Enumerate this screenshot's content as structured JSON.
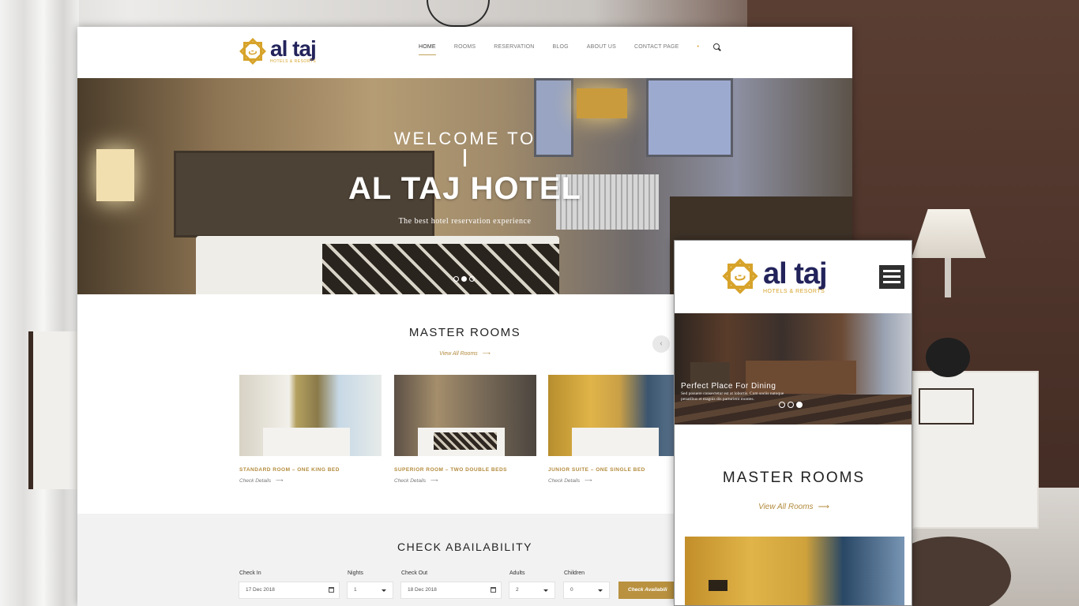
{
  "brand": {
    "logo_glyph": "ت",
    "name": "al taj",
    "tagline": "HOTELS & RESORTS",
    "accent": "#b9913f",
    "navy": "#23235b"
  },
  "nav": {
    "items": [
      "HOME",
      "ROOMS",
      "RESERVATION",
      "BLOG",
      "ABOUT US",
      "CONTACT PAGE"
    ],
    "active": "HOME",
    "dot": "•",
    "search_icon": "search-icon"
  },
  "hero": {
    "welcome": "WELCOME TO",
    "title": "AL TAJ HOTEL",
    "subtitle": "The best hotel reservation experience",
    "slide_count": 3,
    "active_slide": 1
  },
  "rooms": {
    "title": "MASTER ROOMS",
    "view_all": "View All Rooms",
    "arrow": "⟶",
    "prev": "‹",
    "items": [
      {
        "name": "STANDARD ROOM – ONE KING BED",
        "link": "Check Details"
      },
      {
        "name": "SUPERIOR ROOM – TWO DOUBLE BEDS",
        "link": "Check Details"
      },
      {
        "name": "JUNIOR SUITE – ONE SINGLE BED",
        "link": "Check Details"
      }
    ]
  },
  "availability": {
    "title": "CHECK ABAILABILITY",
    "check_in": {
      "label": "Check In",
      "value": "17 Dec 2018"
    },
    "nights": {
      "label": "Nights",
      "value": "1"
    },
    "check_out": {
      "label": "Check Out",
      "value": "18 Dec 2018"
    },
    "adults": {
      "label": "Adults",
      "value": "2"
    },
    "children": {
      "label": "Children",
      "value": "0"
    },
    "button": "Check Availabili"
  },
  "mobile": {
    "hero_title": "Perfect Place For Dining",
    "hero_text": "Sed posuere consectetur est at lobortis. Cum sociis natoque penatibus et magnis dis parturient montes.",
    "rooms_title": "MASTER ROOMS",
    "view_all": "View All Rooms",
    "arrow": "⟶"
  }
}
